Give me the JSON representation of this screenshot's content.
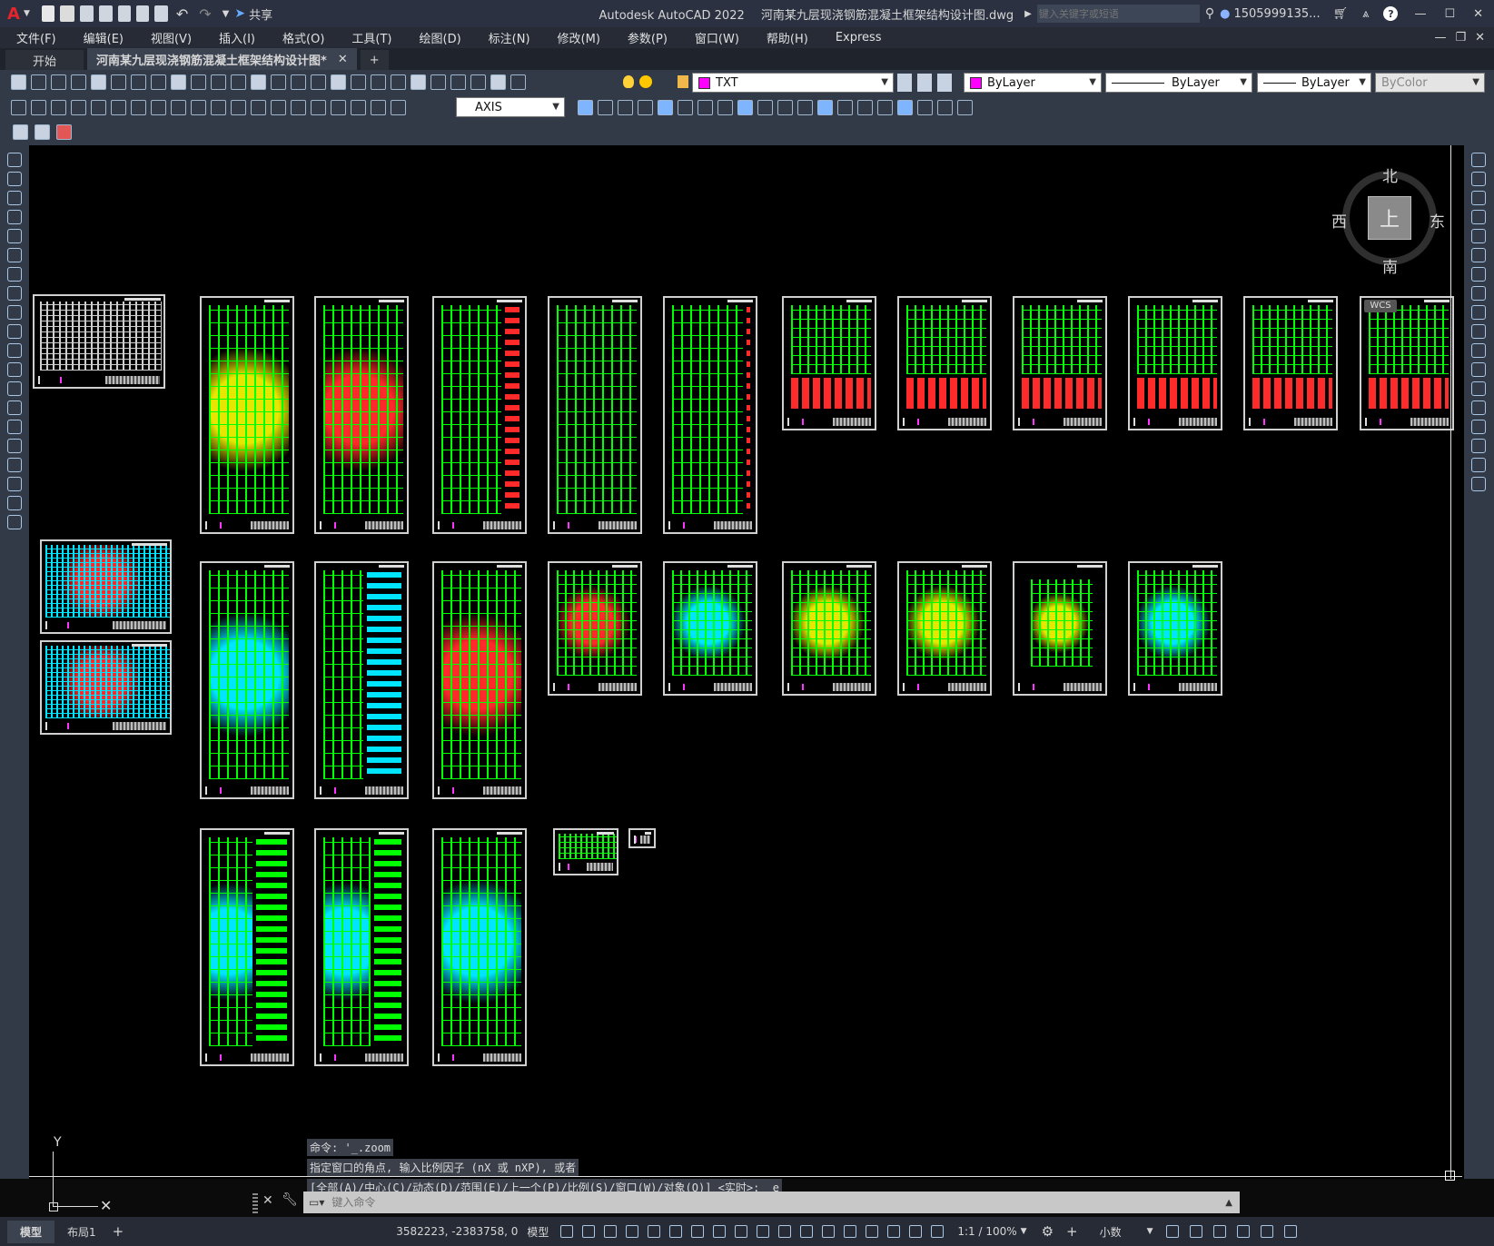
{
  "titlebar": {
    "app_title": "Autodesk AutoCAD 2022",
    "file_title": "河南某九层现浇钢筋混凝土框架结构设计图.dwg",
    "share_label": "共享",
    "search_placeholder": "键入关键字或短语",
    "user": "1505999135...",
    "help": "?"
  },
  "menu": [
    "文件(F)",
    "编辑(E)",
    "视图(V)",
    "插入(I)",
    "格式(O)",
    "工具(T)",
    "绘图(D)",
    "标注(N)",
    "修改(M)",
    "参数(P)",
    "窗口(W)",
    "帮助(H)",
    "Express"
  ],
  "tabs": {
    "start": "开始",
    "active": "河南某九层现浇钢筋混凝土框架结构设计图*",
    "add": "+"
  },
  "toolbar": {
    "layer_name": "TXT",
    "color": "ByLayer",
    "linetype": "ByLayer",
    "lineweight": "ByLayer",
    "plotstyle": "ByColor",
    "dimstyle": "AXIS"
  },
  "viewcube": {
    "north": "北",
    "south": "南",
    "east": "东",
    "west": "西",
    "top": "上",
    "wcs": "WCS"
  },
  "ucs": {
    "y": "Y"
  },
  "command": {
    "history": [
      "命令: '_.zoom",
      "指定窗口的角点, 输入比例因子 (nX 或 nXP), 或者",
      "[全部(A)/中心(C)/动态(D)/范围(E)/上一个(P)/比例(S)/窗口(W)/对象(O)] <实时>: _e"
    ],
    "placeholder": "键入命令"
  },
  "status": {
    "model_tab": "模型",
    "layout_tab": "布局1",
    "add": "+",
    "coords": "3582223, -2383758, 0",
    "mode": "模型",
    "scale": "1:1 / 100%",
    "units": "小数"
  },
  "colors": {
    "green": "#00ff00",
    "yellow": "#e6e600",
    "red": "#ff2a2a",
    "cyan": "#00e5ff",
    "magenta": "#ff33ff",
    "layer_swatch": "#ff00ff",
    "color_swatch": "#ff00ff"
  }
}
